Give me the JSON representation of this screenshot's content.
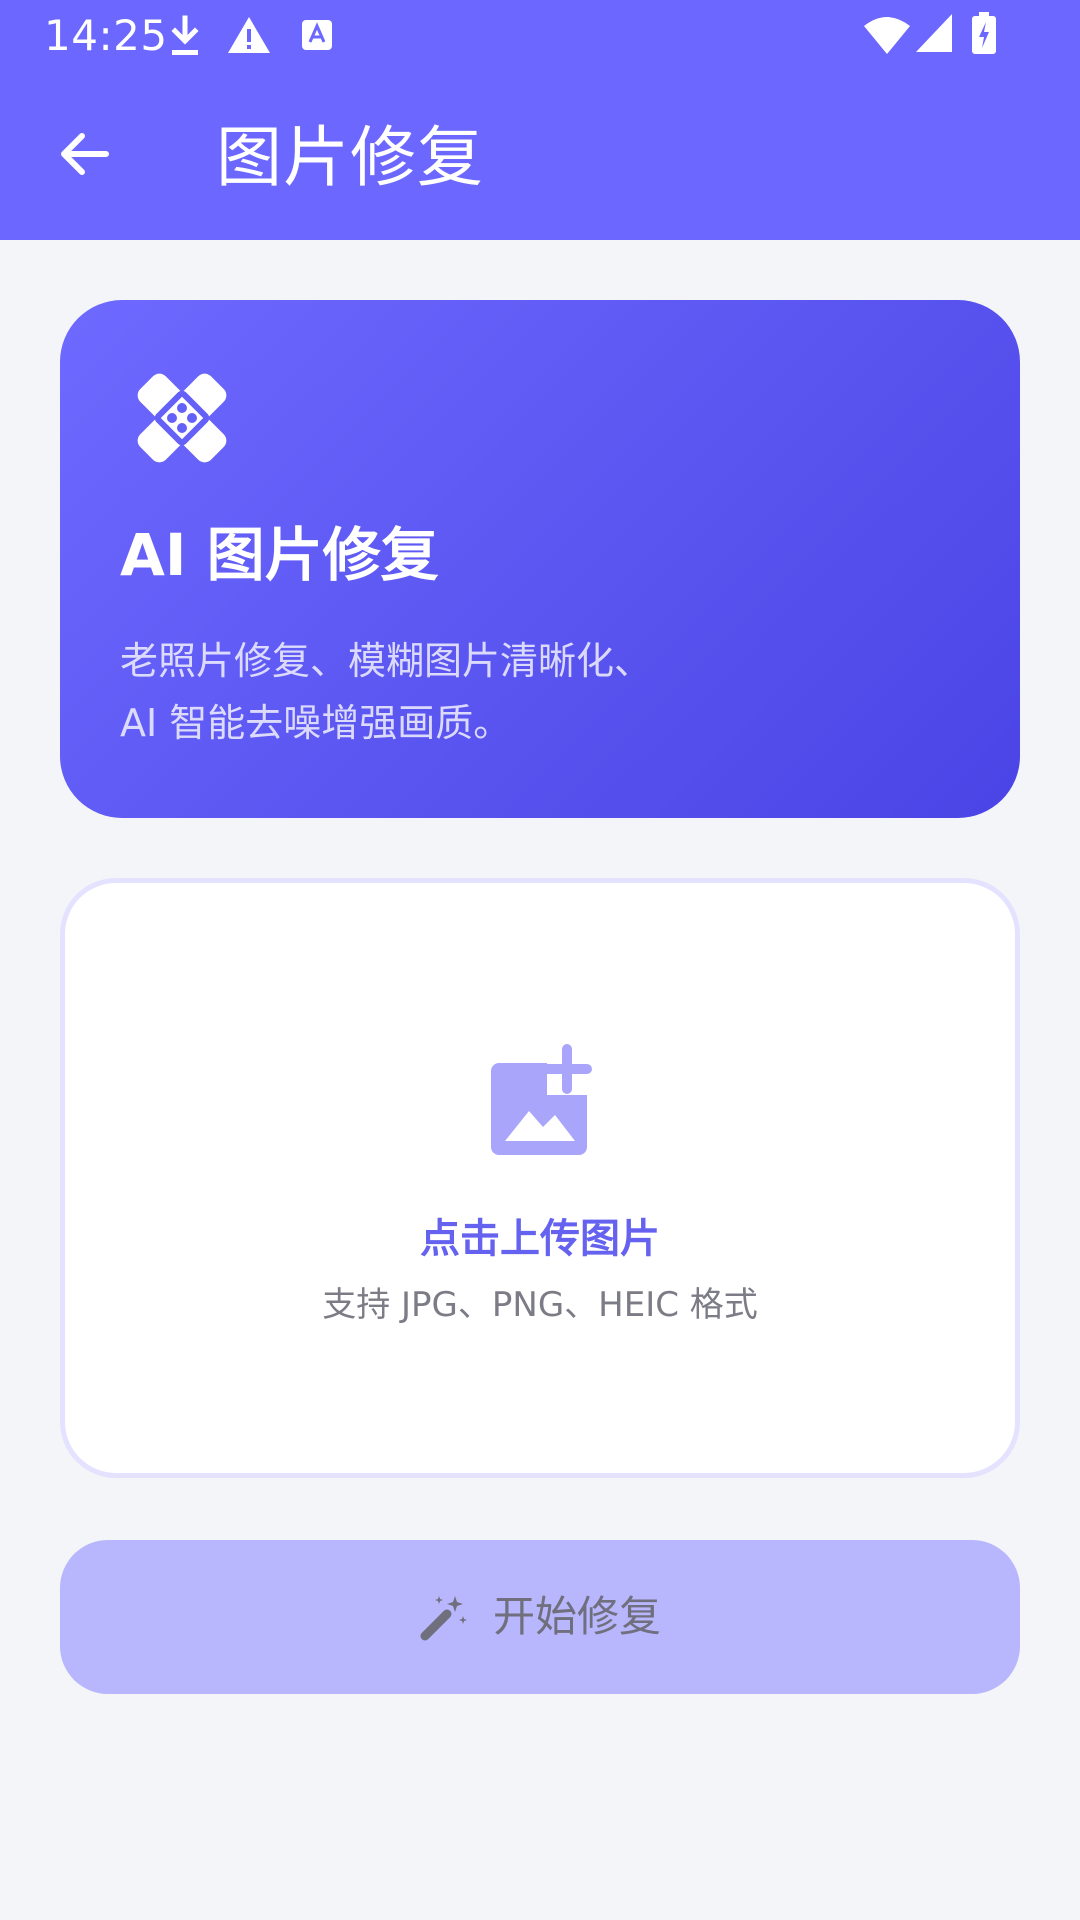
{
  "status_bar": {
    "time": "14:25",
    "icons": [
      "download-icon",
      "warning-icon",
      "accessibility-icon",
      "wifi-icon",
      "signal-icon",
      "battery-charging-icon"
    ]
  },
  "app_bar": {
    "back_icon": "arrow-left-icon",
    "title": "图片修复"
  },
  "hero": {
    "icon": "bandage-icon",
    "title": "AI 图片修复",
    "description_line1": "老照片修复、模糊图片清晰化、",
    "description_line2": "AI 智能去噪增强画质。"
  },
  "upload": {
    "icon": "add-photo-icon",
    "title": "点击上传图片",
    "hint": "支持 JPG、PNG、HEIC 格式"
  },
  "action": {
    "icon": "magic-wand-icon",
    "label": "开始修复"
  },
  "colors": {
    "primary": "#6c68ff",
    "card_gradient_end": "#4a44e6",
    "accent_text": "#6562f0",
    "button_disabled": "#b8b6fc",
    "background": "#f4f5f9"
  }
}
